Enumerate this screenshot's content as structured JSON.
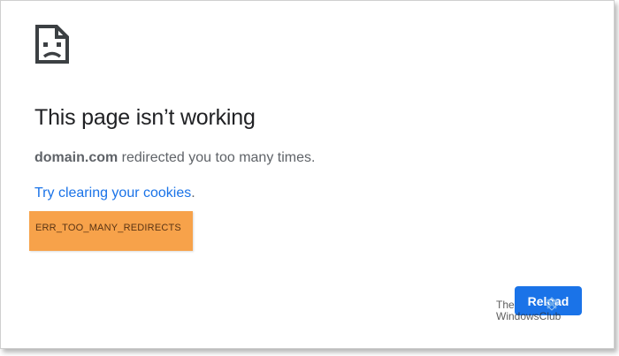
{
  "error_page": {
    "icon": "sad-page-icon",
    "title": "This page isn’t working",
    "message_domain": "domain.com",
    "message_rest": " redirected you too many times.",
    "suggestion_link": "Try clearing your cookies",
    "suggestion_suffix": ".",
    "error_code": "ERR_TOO_MANY_REDIRECTS",
    "reload_label": "Reload"
  },
  "watermark": {
    "line1": "The",
    "line2": "WindowsClub",
    "logo": "windowsclub-logo-icon"
  },
  "colors": {
    "title": "#202124",
    "body_text": "#5f6368",
    "link": "#1a73e8",
    "button": "#1a73e8",
    "error_highlight": "#f7a24a"
  }
}
